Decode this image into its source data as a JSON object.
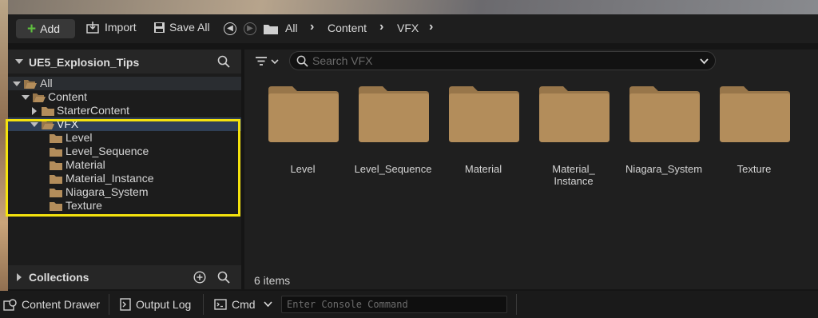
{
  "toolbar": {
    "add_label": "Add",
    "import_label": "Import",
    "save_all_label": "Save All",
    "breadcrumbs": [
      "All",
      "Content",
      "VFX"
    ]
  },
  "sources": {
    "title": "UE5_Explosion_Tips",
    "collections_label": "Collections"
  },
  "tree": {
    "all": "All",
    "content": "Content",
    "starter": "StarterContent",
    "vfx": "VFX",
    "children": [
      "Level",
      "Level_Sequence",
      "Material",
      "Material_Instance",
      "Niagara_System",
      "Texture"
    ]
  },
  "search": {
    "placeholder": "Search VFX"
  },
  "assets": {
    "tiles": [
      "Level",
      "Level_Sequence",
      "Material",
      "Material_\nInstance",
      "Niagara_System",
      "Texture"
    ],
    "count_label": "6 items"
  },
  "statusbar": {
    "content_drawer": "Content Drawer",
    "output_log": "Output Log",
    "cmd": "Cmd",
    "console_placeholder": "Enter Console Command"
  },
  "colors": {
    "folder": "#b38d5b",
    "folder_tab": "#98764a",
    "selection": "#2f3f55",
    "highlight_box": "#f4e20d",
    "add_plus": "#5fbf3f"
  }
}
